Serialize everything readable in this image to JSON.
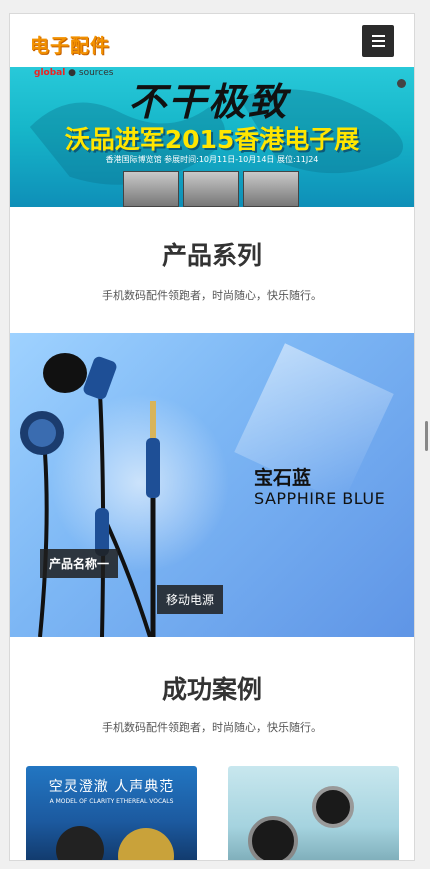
{
  "header": {
    "logo": "电子配件",
    "menu_icon": "hamburger-menu-icon"
  },
  "banner": {
    "brand_left": "global",
    "brand_right": "sources",
    "headline_top": "不干极致",
    "headline_main": "沃品进军2015香港电子展",
    "info": "香港国际博览馆 参展时间:10月11日-10月14日 展位:11J24"
  },
  "products_section": {
    "title": "产品系列",
    "subtitle": "手机数码配件领跑者，时尚随心，快乐随行。",
    "banner_name_cn": "宝石蓝",
    "banner_name_en": "SAPPHIRE BLUE",
    "caption_1": "产品名称一",
    "caption_2": "移动电源"
  },
  "cases_section": {
    "title": "成功案例",
    "subtitle": "手机数码配件领跑者，时尚随心，快乐随行。",
    "card_1_title": "空灵澄澈 人声典范",
    "card_1_sub": "A MODEL OF CLARITY ETHEREAL VOCALS"
  },
  "colors": {
    "logo": "#f29100",
    "menu_bg": "#2b2b2b",
    "banner_yellow": "#ffe600"
  }
}
